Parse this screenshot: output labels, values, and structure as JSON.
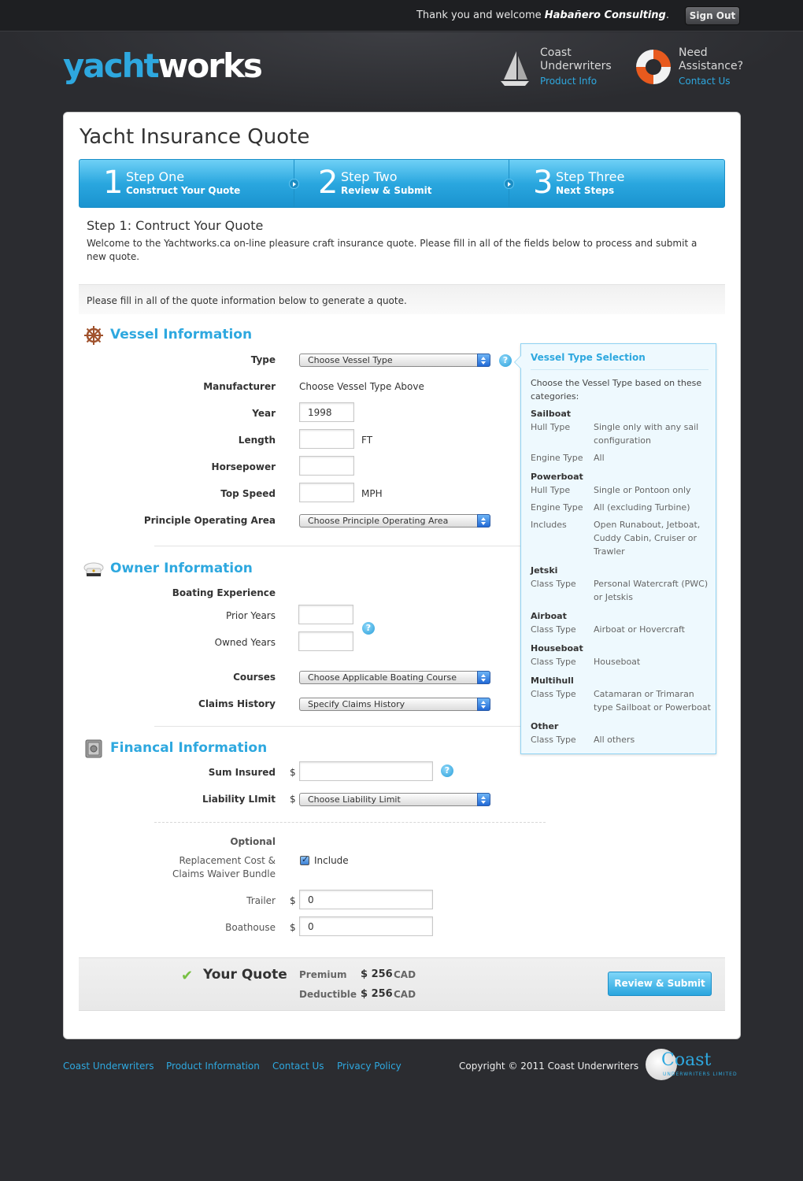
{
  "topbar": {
    "welcome_prefix": "Thank you and welcome",
    "user": "Habañero Consulting",
    "welcome_suffix": ".",
    "signout_label": "Sign Out"
  },
  "header": {
    "logo_part1": "yacht",
    "logo_part2": "works",
    "links": [
      {
        "title_line1": "Coast",
        "title_line2": "Underwriters",
        "link": "Product Info",
        "icon": "sailboat-icon"
      },
      {
        "title_line1": "Need",
        "title_line2": "Assistance?",
        "link": "Contact Us",
        "icon": "life-ring-icon"
      }
    ]
  },
  "page": {
    "title": "Yacht Insurance Quote",
    "steps": [
      {
        "num": "1",
        "title": "Step One",
        "subtitle": "Construct Your Quote"
      },
      {
        "num": "2",
        "title": "Step Two",
        "subtitle": "Review & Submit"
      },
      {
        "num": "3",
        "title": "Step Three",
        "subtitle": "Next Steps"
      }
    ],
    "intro_heading": "Step 1: Contruct Your Quote",
    "intro_text": "Welcome to the Yachtworks.ca on-line pleasure craft insurance quote. Please fill in all of the fields below to process and submit a new quote.",
    "note": "Please fill in all of the quote information below to generate a quote."
  },
  "vessel": {
    "title": "Vessel Information",
    "type_label": "Type",
    "type_value": "Choose Vessel Type",
    "manufacturer_label": "Manufacturer",
    "manufacturer_value": "Choose Vessel Type Above",
    "year_label": "Year",
    "year_value": "1998",
    "length_label": "Length",
    "length_value": "",
    "length_unit": "FT",
    "horsepower_label": "Horsepower",
    "horsepower_value": "",
    "speed_label": "Top Speed",
    "speed_value": "",
    "speed_unit": "MPH",
    "area_label": "Principle Operating Area",
    "area_value": "Choose Principle Operating Area"
  },
  "owner": {
    "title": "Owner Information",
    "experience_label": "Boating Experience",
    "prior_label": "Prior Years",
    "prior_value": "",
    "owned_label": "Owned Years",
    "owned_value": "",
    "courses_label": "Courses",
    "courses_value": "Choose Applicable Boating Course",
    "claims_label": "Claims History",
    "claims_value": "Specify Claims History"
  },
  "financial": {
    "title": "Financal Information",
    "sum_label": "Sum Insured",
    "currency": "$",
    "sum_value": "",
    "liability_label": "Liability LImit",
    "liability_value": "Choose Liability Limit",
    "optional_label": "Optional",
    "bundle_label_1": "Replacement Cost &",
    "bundle_label_2": "Claims Waiver Bundle",
    "include_label": "Include",
    "trailer_label": "Trailer",
    "trailer_value": "0",
    "boathouse_label": "Boathouse",
    "boathouse_value": "0"
  },
  "tooltip": {
    "title": "Vessel Type Selection",
    "intro": "Choose the Vessel Type based on these categories:",
    "sailboat": {
      "name": "Sailboat",
      "k1": "Hull Type",
      "v1": "Single only with any sail configuration",
      "k2": "Engine Type",
      "v2": "All"
    },
    "powerboat": {
      "name": "Powerboat",
      "k1": "Hull Type",
      "v1": "Single or Pontoon only",
      "k2": "Engine Type",
      "v2": "All (excluding Turbine)",
      "k3": "Includes",
      "v3": "Open Runabout, Jetboat, Cuddy Cabin, Cruiser or Trawler"
    },
    "jetski": {
      "name": "Jetski",
      "k1": "Class Type",
      "v1": "Personal Watercraft (PWC) or Jetskis"
    },
    "airboat": {
      "name": "Airboat",
      "k1": "Class Type",
      "v1": "Airboat or Hovercraft"
    },
    "houseboat": {
      "name": "Houseboat",
      "k1": "Class Type",
      "v1": "Houseboat"
    },
    "multihull": {
      "name": "Multihull",
      "k1": "Class Type",
      "v1": "Catamaran or Trimaran type Sailboat or Powerboat"
    },
    "other": {
      "name": "Other",
      "k1": "Class Type",
      "v1": "All others"
    }
  },
  "quote": {
    "title": "Your Quote",
    "premium_label": "Premium",
    "premium_value": "$ 256",
    "premium_currency": "CAD",
    "deductible_label": "Deductible",
    "deductible_value": "$ 256",
    "deductible_currency": "CAD",
    "submit_label": "Review & Submit"
  },
  "footer": {
    "links": [
      "Coast Underwriters",
      "Product Information",
      "Contact Us",
      "Privacy Policy"
    ],
    "copyright": "Copyright © 2011 Coast Underwriters",
    "logo_word": "Coast",
    "logo_sub": "UNDERWRITERS LIMITED"
  }
}
